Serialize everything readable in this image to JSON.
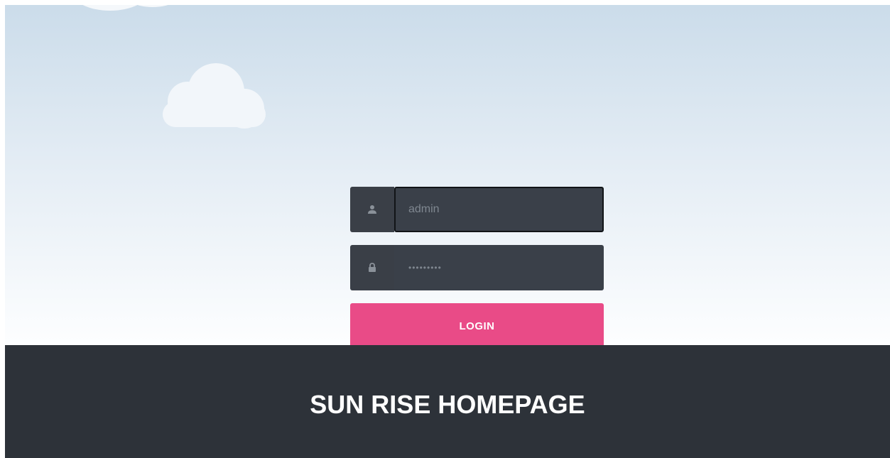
{
  "login": {
    "username_value": "admin",
    "password_value": "•••••••••",
    "button_label": "LOGIN",
    "username_icon": "user-icon",
    "password_icon": "lock-icon"
  },
  "footer": {
    "title": "SUN RISE HOMEPAGE"
  },
  "colors": {
    "accent": "#e94b87",
    "footer_bg": "#2d3239",
    "input_bg": "#3a4049"
  }
}
